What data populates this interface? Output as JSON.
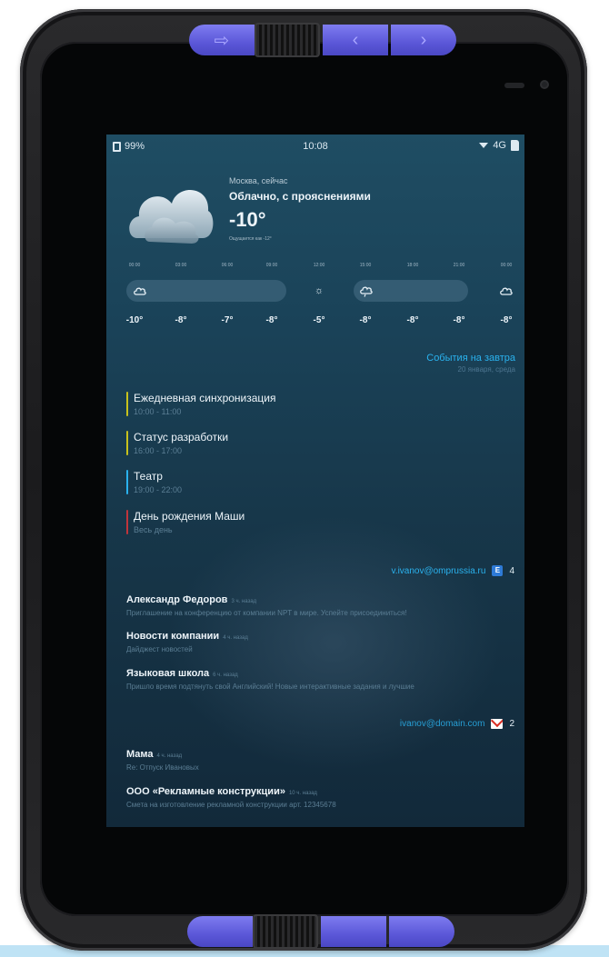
{
  "status_bar": {
    "battery": "99%",
    "time": "10:08",
    "network": "4G"
  },
  "weather": {
    "city": "Москва, сейчас",
    "condition": "Облачно, с прояснениями",
    "temperature": "-10°",
    "feels_like": "Ощущается как -12°",
    "hours": [
      "00:00",
      "03:00",
      "06:00",
      "09:00",
      "12:00",
      "15:00",
      "18:00",
      "21:00",
      "00:00"
    ],
    "hourly_icons": [
      "cloud-icon",
      "sun-icon",
      "rain-cloud-icon",
      "cloud-icon"
    ],
    "hourly_temps": [
      "-10°",
      "-8°",
      "-7°",
      "-8°",
      "-5°",
      "-8°",
      "-8°",
      "-8°",
      "-8°"
    ]
  },
  "events": {
    "title": "События на завтра",
    "date": "20 января, среда",
    "items": [
      {
        "name": "Ежедневная синхронизация",
        "time": "10:00 - 11:00",
        "color": "#c8c21c"
      },
      {
        "name": "Статус разработки",
        "time": "16:00 - 17:00",
        "color": "#c8c21c"
      },
      {
        "name": "Театр",
        "time": "19:00 - 22:00",
        "color": "#2ab2ee"
      },
      {
        "name": "День рождения Маши",
        "time": "Весь день",
        "color": "#c0343b"
      }
    ]
  },
  "mail": {
    "accounts": [
      {
        "address": "v.ivanov@omprussia.ru",
        "icon": "exchange-icon",
        "count": "4",
        "messages": [
          {
            "from": "Александр Федоров",
            "age": "3 ч. назад",
            "subject": "Приглашение на конференцию от компании NPT в мире. Успейте присоединиться!"
          },
          {
            "from": "Новости компании",
            "age": "4 ч. назад",
            "subject": "Дайджест новостей"
          },
          {
            "from": "Языковая школа",
            "age": "6 ч. назад",
            "subject": "Пришло время подтянуть свой Английский! Новые интерактивные задания и лучшие"
          }
        ]
      },
      {
        "address": "ivanov@domain.com",
        "icon": "gmail-icon",
        "count": "2",
        "messages": [
          {
            "from": "Мама",
            "age": "4 ч. назад",
            "subject": "Re: Отпуск Ивановых"
          },
          {
            "from": "ООО «Рекламные конструкции»",
            "age": "10 ч. назад",
            "subject": "Смета на изготовление рекламной конструкции арт. 12345678"
          }
        ]
      }
    ]
  }
}
